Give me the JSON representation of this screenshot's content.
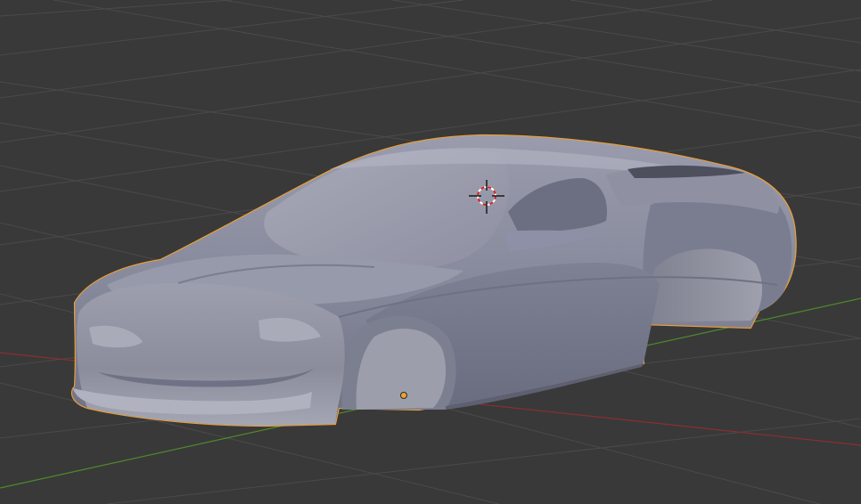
{
  "viewport": {
    "background_color": "#393939",
    "grid_line_color": "#4a4a4a",
    "x_axis_color": "#8a2f2f",
    "y_axis_color": "#4e8a2a",
    "selection_outline_color": "#f0a030",
    "mesh_base_color": "#8a8c9e",
    "cursor_icon": "3d-cursor-icon",
    "origin_icon": "object-origin-dot-icon",
    "object": {
      "name": "car-body-mesh",
      "selected": true
    }
  }
}
